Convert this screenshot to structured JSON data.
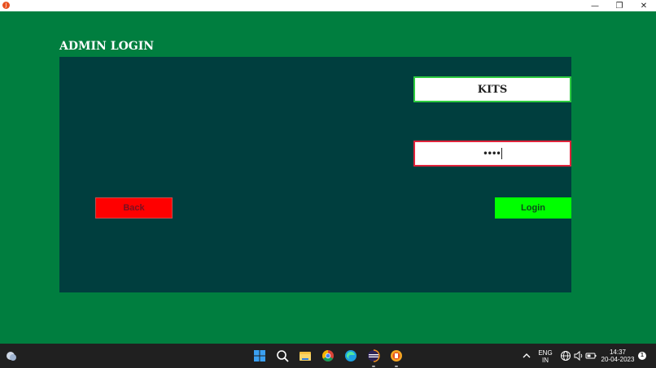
{
  "window": {
    "app_icon_letter": "ﷺ",
    "minimize": "—",
    "restore": "❐",
    "close": "✕"
  },
  "login": {
    "heading": "ADMIN LOGIN",
    "username_value": "KITS",
    "password_mask": "••••",
    "back_label": "Back",
    "login_label": "Login"
  },
  "taskbar": {
    "language": "ENG",
    "region": "IN",
    "time": "14:37",
    "date": "20-04-2023",
    "notification_count": "1",
    "icons": [
      "weather-icon",
      "windows-start-icon",
      "search-icon",
      "file-explorer-icon",
      "chrome-icon",
      "edge-icon",
      "eclipse-icon",
      "java-app-icon",
      "chevron-up-icon",
      "network-icon",
      "volume-icon",
      "battery-icon"
    ]
  },
  "colors": {
    "background": "#007e3f",
    "panel": "#003e3e",
    "back": "#ff0000",
    "login": "#00ff00",
    "user_border": "#2ecc40",
    "pass_border": "#e0233b"
  }
}
